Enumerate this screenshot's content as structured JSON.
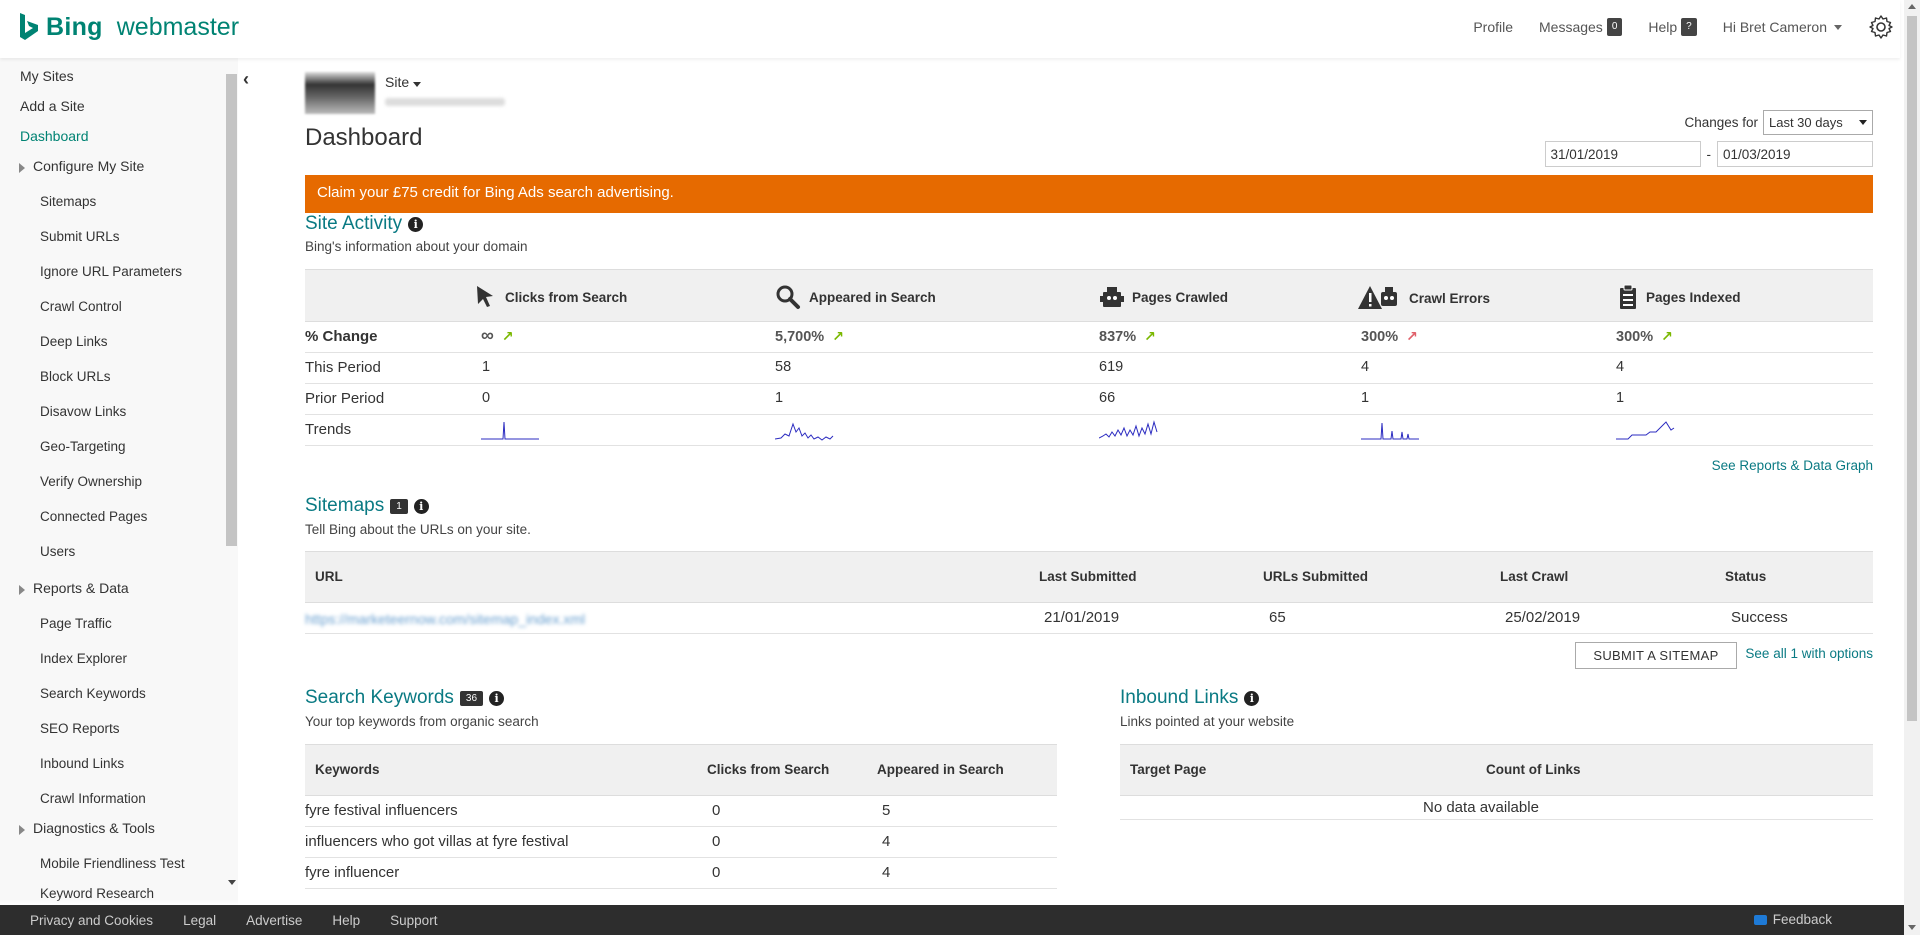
{
  "header": {
    "brand": "Bing",
    "product": "webmaster",
    "nav": {
      "profile": "Profile",
      "messages": "Messages",
      "messages_count": "0",
      "help": "Help",
      "help_badge": "?",
      "user": "Hi Bret Cameron"
    }
  },
  "sidebar": {
    "items": [
      {
        "label": "My Sites",
        "type": "top"
      },
      {
        "label": "Add a Site",
        "type": "top"
      },
      {
        "label": "Dashboard",
        "type": "top",
        "active": true
      },
      {
        "label": "Configure My Site",
        "type": "group"
      },
      {
        "label": "Sitemaps",
        "type": "sub"
      },
      {
        "label": "Submit URLs",
        "type": "sub"
      },
      {
        "label": "Ignore URL Parameters",
        "type": "sub"
      },
      {
        "label": "Crawl Control",
        "type": "sub"
      },
      {
        "label": "Deep Links",
        "type": "sub"
      },
      {
        "label": "Block URLs",
        "type": "sub"
      },
      {
        "label": "Disavow Links",
        "type": "sub"
      },
      {
        "label": "Geo-Targeting",
        "type": "sub"
      },
      {
        "label": "Verify Ownership",
        "type": "sub"
      },
      {
        "label": "Connected Pages",
        "type": "sub"
      },
      {
        "label": "Users",
        "type": "sub"
      },
      {
        "label": "Reports & Data",
        "type": "group"
      },
      {
        "label": "Page Traffic",
        "type": "sub"
      },
      {
        "label": "Index Explorer",
        "type": "sub"
      },
      {
        "label": "Search Keywords",
        "type": "sub"
      },
      {
        "label": "SEO Reports",
        "type": "sub"
      },
      {
        "label": "Inbound Links",
        "type": "sub"
      },
      {
        "label": "Crawl Information",
        "type": "sub"
      },
      {
        "label": "Diagnostics & Tools",
        "type": "group"
      },
      {
        "label": "Mobile Friendliness Test",
        "type": "sub"
      },
      {
        "label": "Keyword Research",
        "type": "sub"
      }
    ]
  },
  "site": {
    "label": "Site",
    "url": "marketeernow.com"
  },
  "page_title": "Dashboard",
  "changes": {
    "label": "Changes for",
    "selected": "Last 30 days",
    "date_from": "31/01/2019",
    "date_sep": "-",
    "date_to": "01/03/2019"
  },
  "promo": "Claim your £75 credit for Bing Ads search advertising.",
  "site_activity": {
    "title": "Site Activity",
    "subtitle": "Bing's information about your domain",
    "columns": [
      {
        "label": "Clicks from Search",
        "icon": "cursor-icon"
      },
      {
        "label": "Appeared in Search",
        "icon": "magnifier-icon"
      },
      {
        "label": "Pages Crawled",
        "icon": "robot-icon"
      },
      {
        "label": "Crawl Errors",
        "icon": "error-robot-icon"
      },
      {
        "label": "Pages Indexed",
        "icon": "clipboard-icon"
      }
    ],
    "rows": {
      "change_label": "% Change",
      "this_label": "This Period",
      "prior_label": "Prior Period",
      "trends_label": "Trends"
    },
    "change": [
      "∞",
      "5,700%",
      "837%",
      "300%",
      "300%"
    ],
    "change_direction": [
      "up-good",
      "up-good",
      "up-good",
      "up-bad",
      "up-good"
    ],
    "this_period": [
      "1",
      "58",
      "619",
      "4",
      "4"
    ],
    "prior_period": [
      "0",
      "1",
      "66",
      "1",
      "1"
    ],
    "see_reports": "See Reports & Data Graph",
    "colors": {
      "good": "#7ab800",
      "bad": "#e0606a",
      "trend": "#2b2bc0"
    }
  },
  "sitemaps": {
    "title": "Sitemaps",
    "count": "1",
    "subtitle": "Tell Bing about the URLs on your site.",
    "headers": [
      "URL",
      "Last Submitted",
      "URLs Submitted",
      "Last Crawl",
      "Status"
    ],
    "rows": [
      [
        "https://marketeernow.com/sitemap_index.xml",
        "21/01/2019",
        "65",
        "25/02/2019",
        "Success"
      ]
    ],
    "submit_button": "SUBMIT A SITEMAP",
    "see_all": "See all 1 with options"
  },
  "keywords": {
    "title": "Search Keywords",
    "count": "36",
    "subtitle": "Your top keywords from organic search",
    "headers": [
      "Keywords",
      "Clicks from Search",
      "Appeared in Search"
    ],
    "rows": [
      [
        "fyre festival influencers",
        "0",
        "5"
      ],
      [
        "influencers who got villas at fyre festival",
        "0",
        "4"
      ],
      [
        "fyre influencer",
        "0",
        "4"
      ]
    ]
  },
  "inbound": {
    "title": "Inbound Links",
    "subtitle": "Links pointed at your website",
    "headers": [
      "Target Page",
      "Count of Links"
    ],
    "empty": "No data available"
  },
  "footer": {
    "links": [
      "Privacy and Cookies",
      "Legal",
      "Advertise",
      "Help",
      "Support"
    ],
    "feedback": "Feedback"
  },
  "brand_color": "#008373",
  "promo_color": "#e66a00"
}
